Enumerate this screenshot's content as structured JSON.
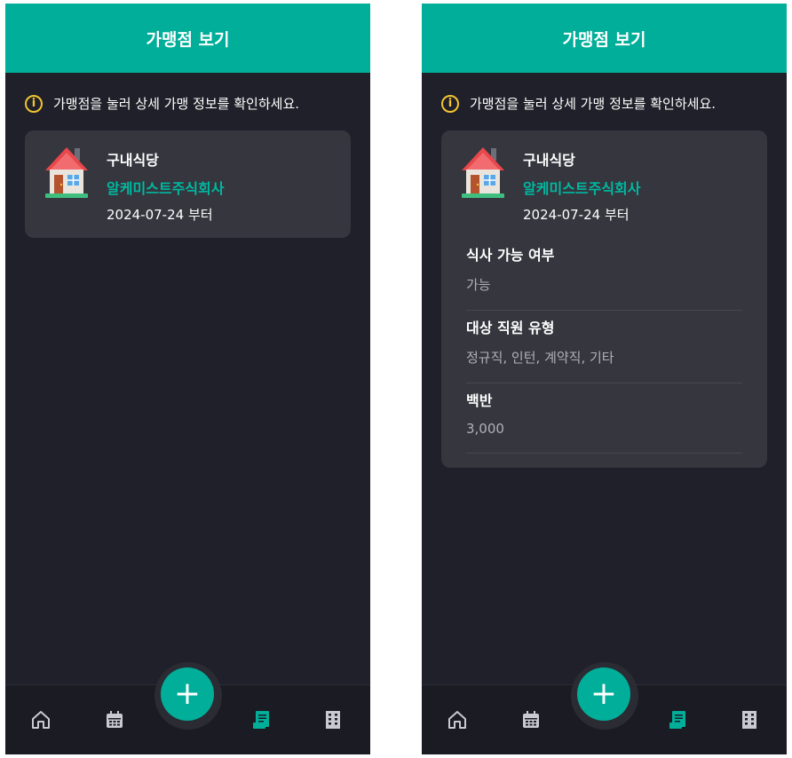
{
  "colors": {
    "accent": "#00ae99",
    "background": "#1f2029",
    "card": "#35363e",
    "warning": "#f2c531"
  },
  "screens": [
    {
      "header_title": "가맹점 보기",
      "info_icon": "info-icon",
      "info_text": "가맹점을 눌러 상세 가맹 정보를 확인하세요.",
      "store": {
        "icon": "house-icon",
        "name": "구내식당",
        "company": "알케미스트주식회사",
        "date": "2024-07-24 부터"
      },
      "nav": {
        "fab_label": "+",
        "items": [
          "home-icon",
          "calendar-icon",
          "receipt-icon",
          "building-icon"
        ],
        "active": "receipt-icon"
      }
    },
    {
      "header_title": "가맹점 보기",
      "info_icon": "info-icon",
      "info_text": "가맹점을 눌러 상세 가맹 정보를 확인하세요.",
      "store": {
        "icon": "house-icon",
        "name": "구내식당",
        "company": "알케미스트주식회사",
        "date": "2024-07-24 부터"
      },
      "details": [
        {
          "label": "식사 가능 여부",
          "value": "가능"
        },
        {
          "label": "대상 직원 유형",
          "value": "정규직, 인턴, 계약직, 기타"
        },
        {
          "label": "백반",
          "value": "3,000"
        }
      ],
      "nav": {
        "fab_label": "+",
        "items": [
          "home-icon",
          "calendar-icon",
          "receipt-icon",
          "building-icon"
        ],
        "active": "receipt-icon"
      }
    }
  ]
}
